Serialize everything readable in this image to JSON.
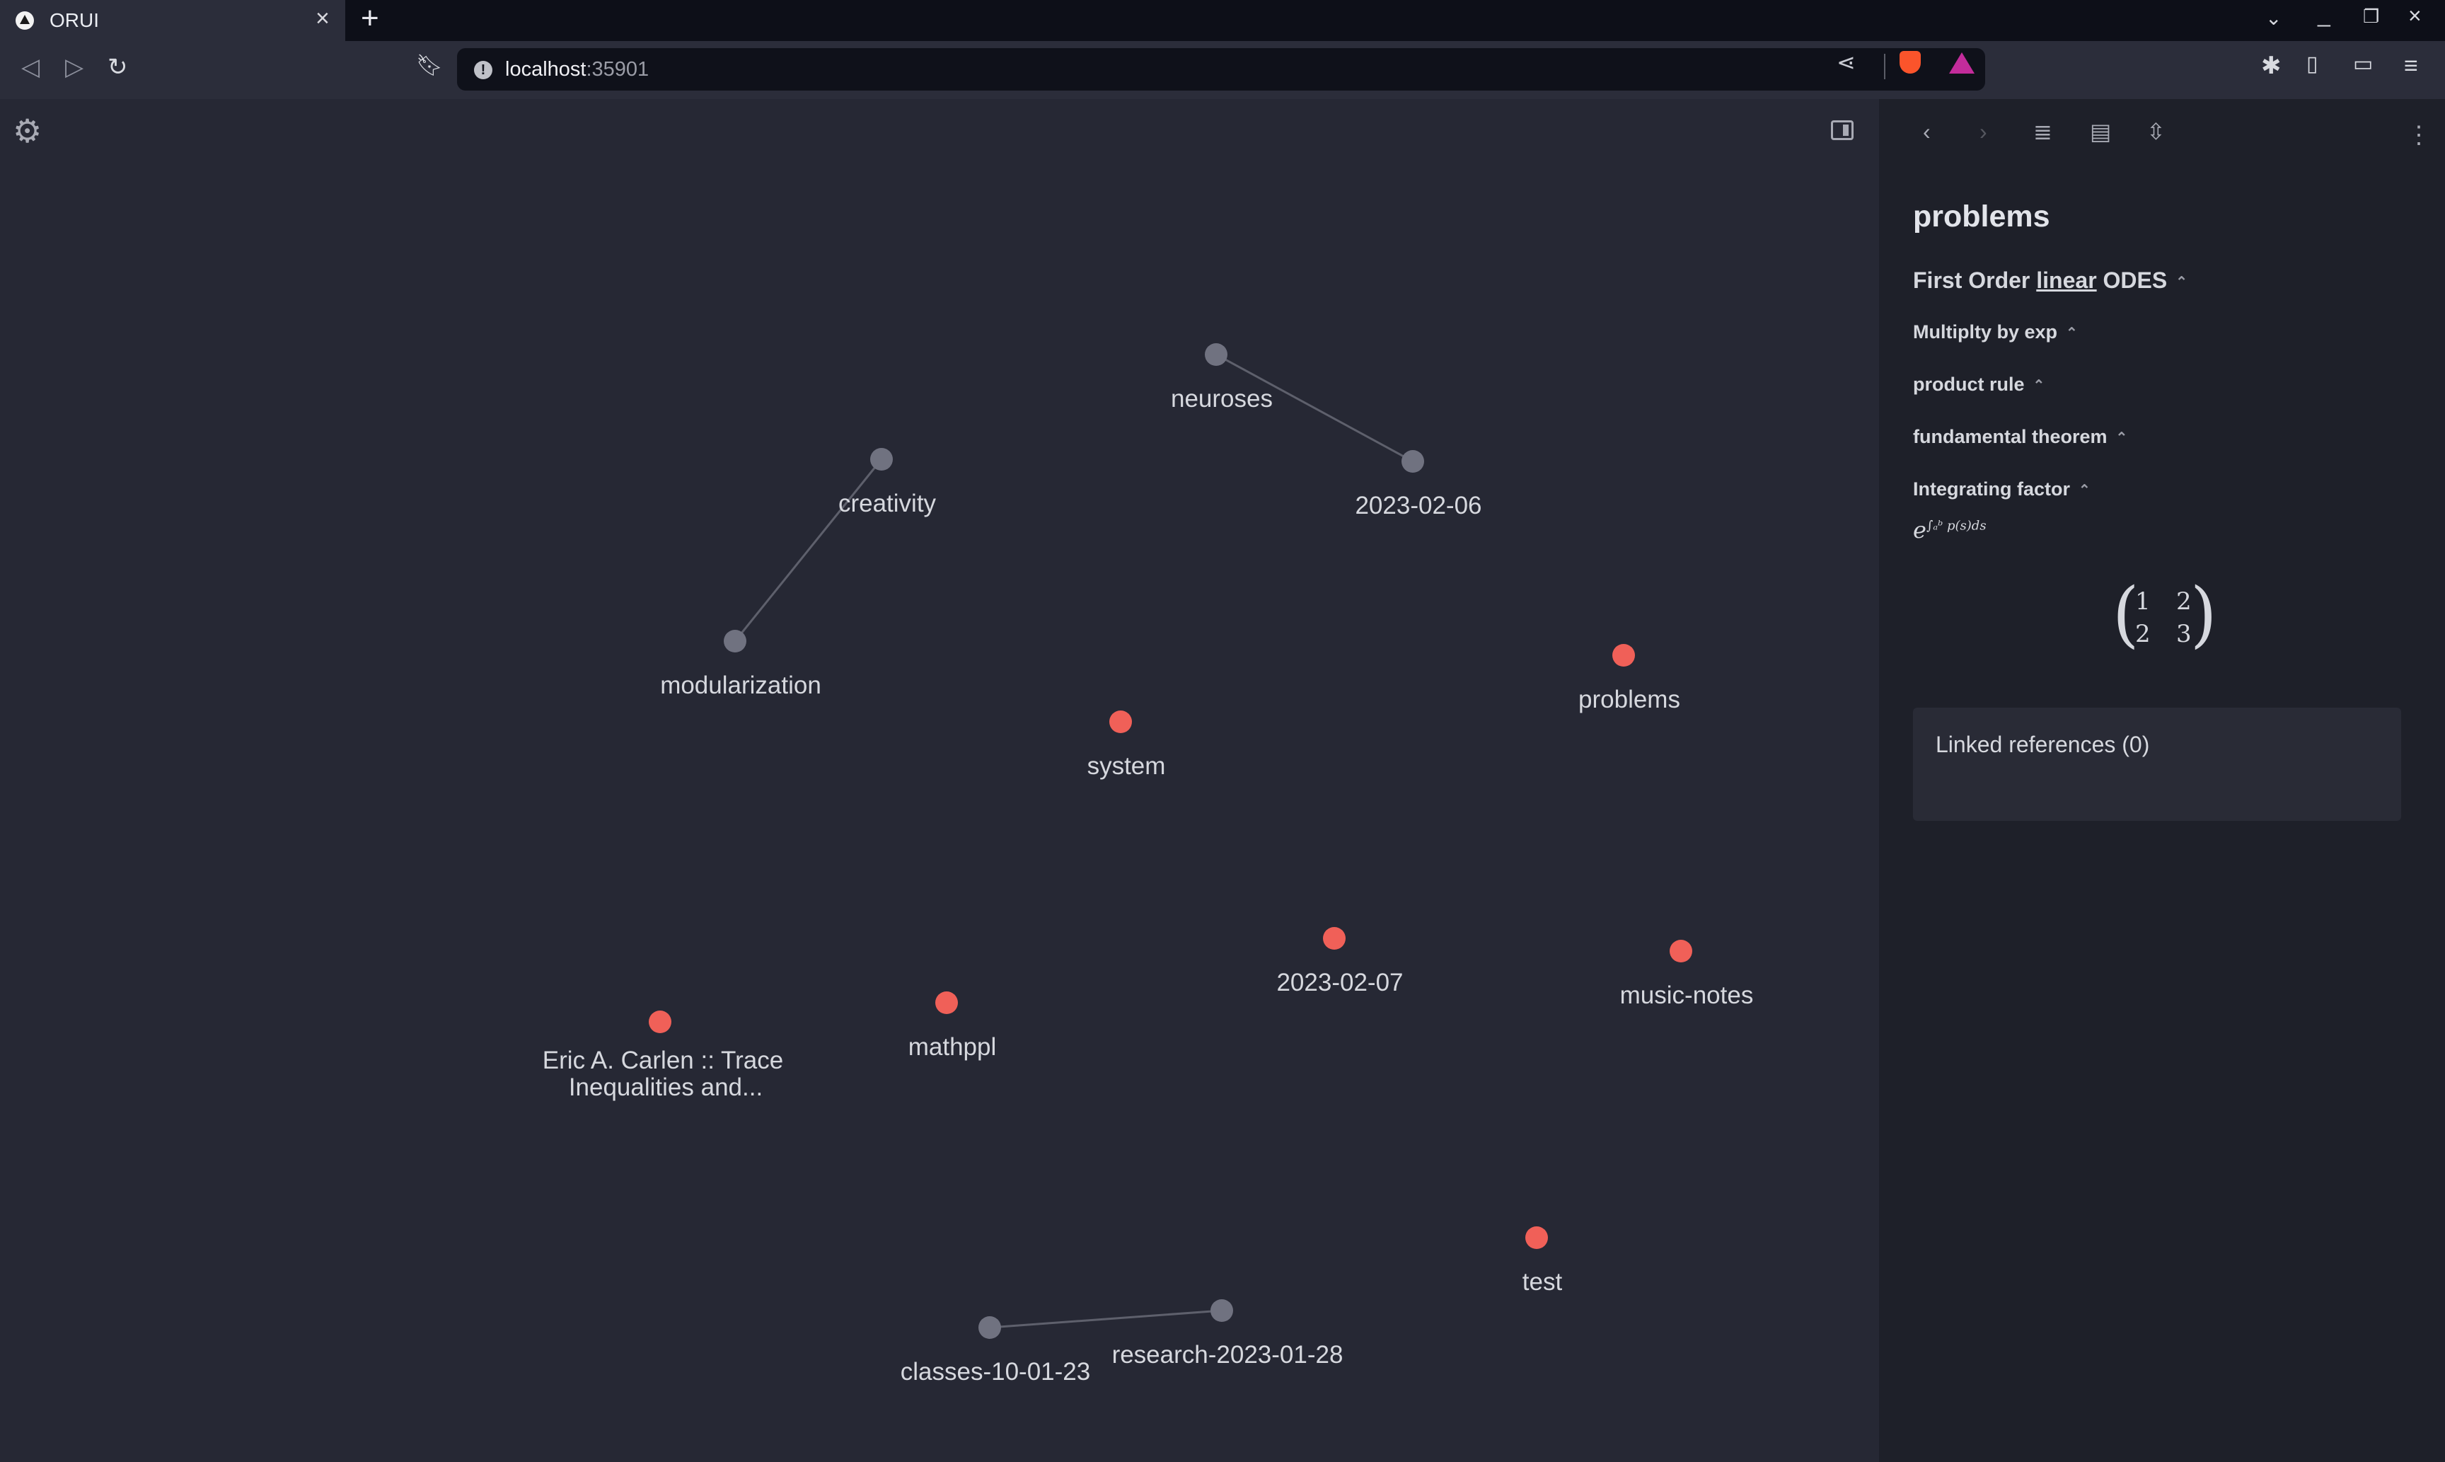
{
  "browser": {
    "tab_title": "ORUI",
    "url_host": "localhost",
    "url_port": ":35901",
    "icons": {
      "back": "back-icon",
      "forward": "forward-icon",
      "reload": "reload-icon",
      "bookmark": "bookmark-icon",
      "share": "share-icon",
      "shields": "brave-shields-icon",
      "rewards": "brave-rewards-icon",
      "extensions": "extensions-icon",
      "sidebar": "sidebar-icon",
      "wallet": "wallet-icon",
      "menu": "menu-icon"
    }
  },
  "graph": {
    "nodes": [
      {
        "id": "neuroses",
        "label": "neuroses",
        "kind": "linked"
      },
      {
        "id": "2023-02-06",
        "label": "2023-02-06",
        "kind": "linked"
      },
      {
        "id": "creativity",
        "label": "creativity",
        "kind": "linked"
      },
      {
        "id": "modularization",
        "label": "modularization",
        "kind": "linked"
      },
      {
        "id": "problems",
        "label": "problems",
        "kind": "orphan"
      },
      {
        "id": "system",
        "label": "system",
        "kind": "orphan"
      },
      {
        "id": "2023-02-07",
        "label": "2023-02-07",
        "kind": "orphan"
      },
      {
        "id": "music-notes",
        "label": "music-notes",
        "kind": "orphan"
      },
      {
        "id": "mathppl",
        "label": "mathppl",
        "kind": "orphan"
      },
      {
        "id": "carlen",
        "label": "Eric A. Carlen :: Trace Inequalities and...",
        "kind": "orphan"
      },
      {
        "id": "test",
        "label": "test",
        "kind": "orphan"
      },
      {
        "id": "classes-10-01-23",
        "label": "classes-10-01-23",
        "kind": "linked"
      },
      {
        "id": "research-2023-01-28",
        "label": "research-2023-01-28",
        "kind": "linked"
      }
    ],
    "edges": [
      [
        "neuroses",
        "2023-02-06"
      ],
      [
        "creativity",
        "modularization"
      ],
      [
        "classes-10-01-23",
        "research-2023-01-28"
      ]
    ],
    "colors": {
      "linked": "#707280",
      "orphan": "#f06058",
      "edge": "#5e606c"
    }
  },
  "sidebar": {
    "page_title": "problems",
    "headings": [
      {
        "pre": "First Order ",
        "link": "linear",
        "post": " ODES",
        "level": 1
      },
      {
        "text": "Multiplty by exp",
        "level": 3
      },
      {
        "text": "product rule",
        "level": 3
      },
      {
        "text": "fundamental theorem",
        "level": 3
      },
      {
        "text": "Integrating factor",
        "level": 3
      }
    ],
    "formula": {
      "base": "e",
      "exponent": "∫ₐᵇ p(s)ds"
    },
    "matrix": [
      "1",
      "2",
      "2",
      "3"
    ],
    "linked_references": "Linked references (0)"
  }
}
